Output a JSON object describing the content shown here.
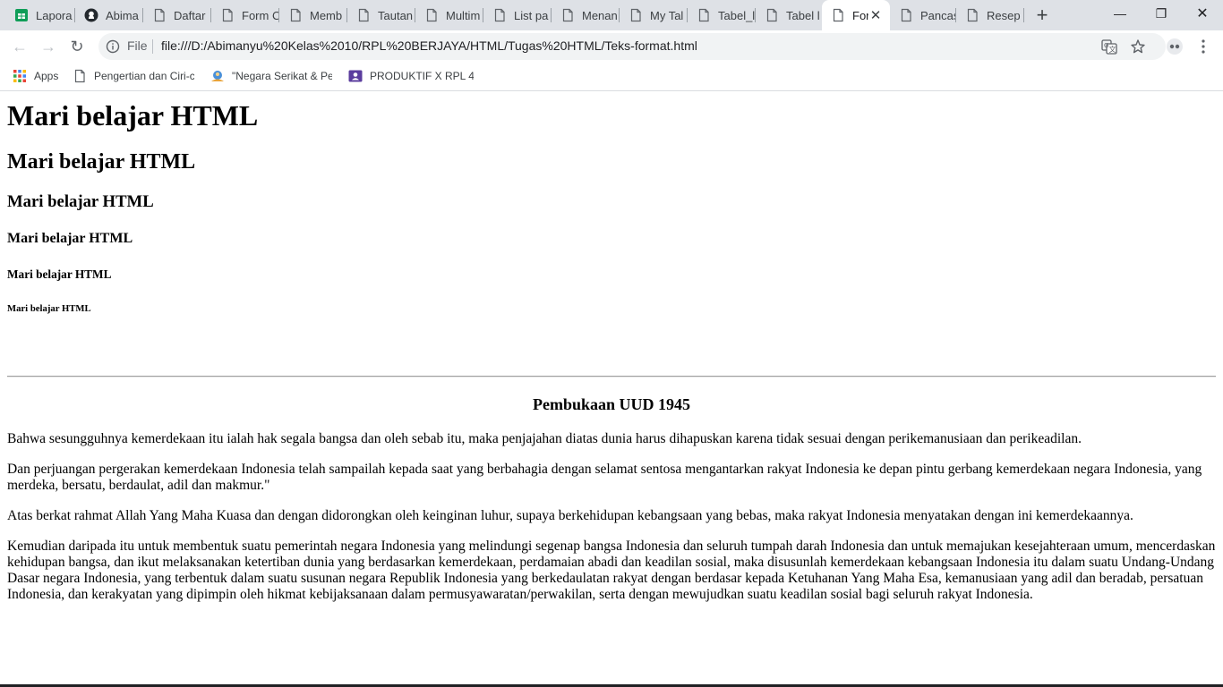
{
  "browser": {
    "tabs": [
      {
        "label": "Lapora",
        "icon": "sheets-icon"
      },
      {
        "label": "Abima",
        "icon": "github-icon"
      },
      {
        "label": "Daftar",
        "icon": "page-icon"
      },
      {
        "label": "Form C",
        "icon": "page-icon"
      },
      {
        "label": "Memb",
        "icon": "page-icon"
      },
      {
        "label": "Tautan",
        "icon": "page-icon"
      },
      {
        "label": "Multim",
        "icon": "page-icon"
      },
      {
        "label": "List pa",
        "icon": "page-icon"
      },
      {
        "label": "Menan",
        "icon": "page-icon"
      },
      {
        "label": "My Tal",
        "icon": "page-icon"
      },
      {
        "label": "Tabel_l",
        "icon": "page-icon"
      },
      {
        "label": "Tabel l",
        "icon": "page-icon"
      },
      {
        "label": "For",
        "icon": "page-icon",
        "active": true
      },
      {
        "label": "Pancas",
        "icon": "page-icon"
      },
      {
        "label": "Resep",
        "icon": "page-icon"
      }
    ],
    "new_tab": "+",
    "window_controls": {
      "minimize": "—",
      "restore": "❐",
      "close": "✕"
    },
    "nav": {
      "back": "←",
      "forward": "→",
      "reload": "↻"
    },
    "omnibox": {
      "scheme_label": "File",
      "url": "file:///D:/Abimanyu%20Kelas%2010/RPL%20BERJAYA/HTML/Tugas%20HTML/Teks-format.html"
    },
    "bookmarks": [
      {
        "label": "Apps",
        "icon": "apps-grid-icon"
      },
      {
        "label": "Pengertian dan Ciri-c",
        "icon": "page-icon"
      },
      {
        "label": "\"Negara Serikat & Pe",
        "icon": "globe-people-icon"
      },
      {
        "label": "PRODUKTIF X RPL 4 -",
        "icon": "classroom-icon"
      }
    ],
    "accent": "#1a73e8"
  },
  "content": {
    "headings": [
      "Mari belajar HTML",
      "Mari belajar HTML",
      "Mari belajar HTML",
      "Mari belajar HTML",
      "Mari belajar HTML",
      "Mari belajar HTML"
    ],
    "title": "Pembukaan UUD 1945",
    "paragraphs": [
      "Bahwa sesungguhnya kemerdekaan itu ialah hak segala bangsa dan oleh sebab itu, maka penjajahan diatas dunia harus dihapuskan karena tidak sesuai dengan perikemanusiaan dan perikeadilan.",
      "Dan perjuangan pergerakan kemerdekaan Indonesia telah sampailah kepada saat yang berbahagia dengan selamat sentosa mengantarkan rakyat Indonesia ke depan pintu gerbang kemerdekaan negara Indonesia, yang merdeka, bersatu, berdaulat, adil dan makmur.\"",
      "Atas berkat rahmat Allah Yang Maha Kuasa dan dengan didorongkan oleh keinginan luhur, supaya berkehidupan kebangsaan yang bebas, maka rakyat Indonesia menyatakan dengan ini kemerdekaannya.",
      "Kemudian daripada itu untuk membentuk suatu pemerintah negara Indonesia yang melindungi segenap bangsa Indonesia dan seluruh tumpah darah Indonesia dan untuk memajukan kesejahteraan umum, mencerdaskan kehidupan bangsa, dan ikut melaksanakan ketertiban dunia yang berdasarkan kemerdekaan, perdamaian abadi dan keadilan sosial, maka disusunlah kemerdekaan kebangsaan Indonesia itu dalam suatu Undang-Undang Dasar negara Indonesia, yang terbentuk dalam suatu susunan negara Republik Indonesia yang berkedaulatan rakyat dengan berdasar kepada Ketuhanan Yang Maha Esa, kemanusiaan yang adil dan beradab, persatuan Indonesia, dan kerakyatan yang dipimpin oleh hikmat kebijaksanaan dalam permusyawaratan/perwakilan, serta dengan mewujudkan suatu keadilan sosial bagi seluruh rakyat Indonesia."
    ]
  }
}
